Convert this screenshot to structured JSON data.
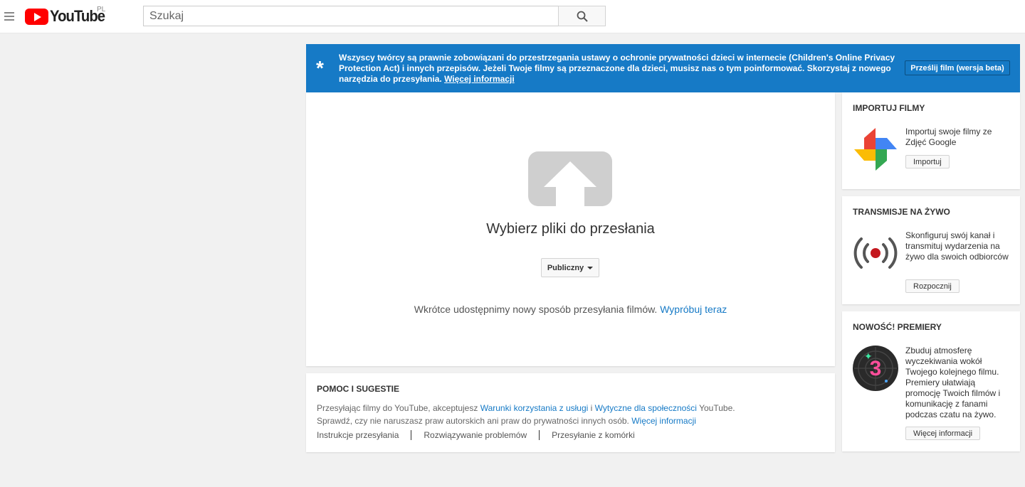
{
  "header": {
    "logo_text": "YouTube",
    "country": "PL",
    "search_placeholder": "Szukaj"
  },
  "banner": {
    "text": "Wszyscy twórcy są prawnie zobowiązani do przestrzegania ustawy o ochronie prywatności dzieci w internecie (Children's Online Privacy Protection Act) i innych przepisów. Jeżeli Twoje filmy są przeznaczone dla dzieci, musisz nas o tym poinformować. Skorzystaj z nowego narzędzia do przesyłania.",
    "link": "Więcej informacji",
    "button": "Prześlij film (wersja beta)",
    "color": "#167ac6"
  },
  "upload": {
    "title": "Wybierz pliki do przesłania",
    "privacy_value": "Publiczny",
    "soon_text": "Wkrótce udostępnimy nowy sposób przesyłania filmów.",
    "soon_link": "Wypróbuj teraz"
  },
  "help": {
    "title": "POMOC I SUGESTIE",
    "line1_before": "Przesyłając filmy do YouTube, akceptujesz",
    "line1_link1": "Warunki korzystania z usługi",
    "line1_mid": "i",
    "line1_link2": "Wytyczne dla społeczności",
    "line1_after": "YouTube.",
    "line2_text": "Sprawdź, czy nie naruszasz praw autorskich ani praw do prywatności innych osób.",
    "line2_link": "Więcej informacji",
    "links": [
      "Instrukcje przesyłania",
      "Rozwiązywanie problemów",
      "Przesyłanie z komórki"
    ]
  },
  "sidebar": {
    "import": {
      "title": "IMPORTUJ FILMY",
      "text": "Importuj swoje filmy ze Zdjęć Google",
      "button": "Importuj",
      "icon": "google-photos-icon"
    },
    "live": {
      "title": "TRANSMISJE NA ŻYWO",
      "text": "Skonfiguruj swój kanał i transmituj wydarzenia na żywo dla swoich odbiorców",
      "button": "Rozpocznij",
      "icon": "live-broadcast-icon"
    },
    "premieres": {
      "title": "NOWOŚĆ! PREMIERY",
      "text": "Zbuduj atmosferę wyczekiwania wokół Twojego kolejnego filmu. Premiery ułatwiają promocję Twoich filmów i komunikację z fanami podczas czatu na żywo.",
      "button": "Więcej informacji",
      "icon": "premiere-countdown-icon"
    }
  }
}
